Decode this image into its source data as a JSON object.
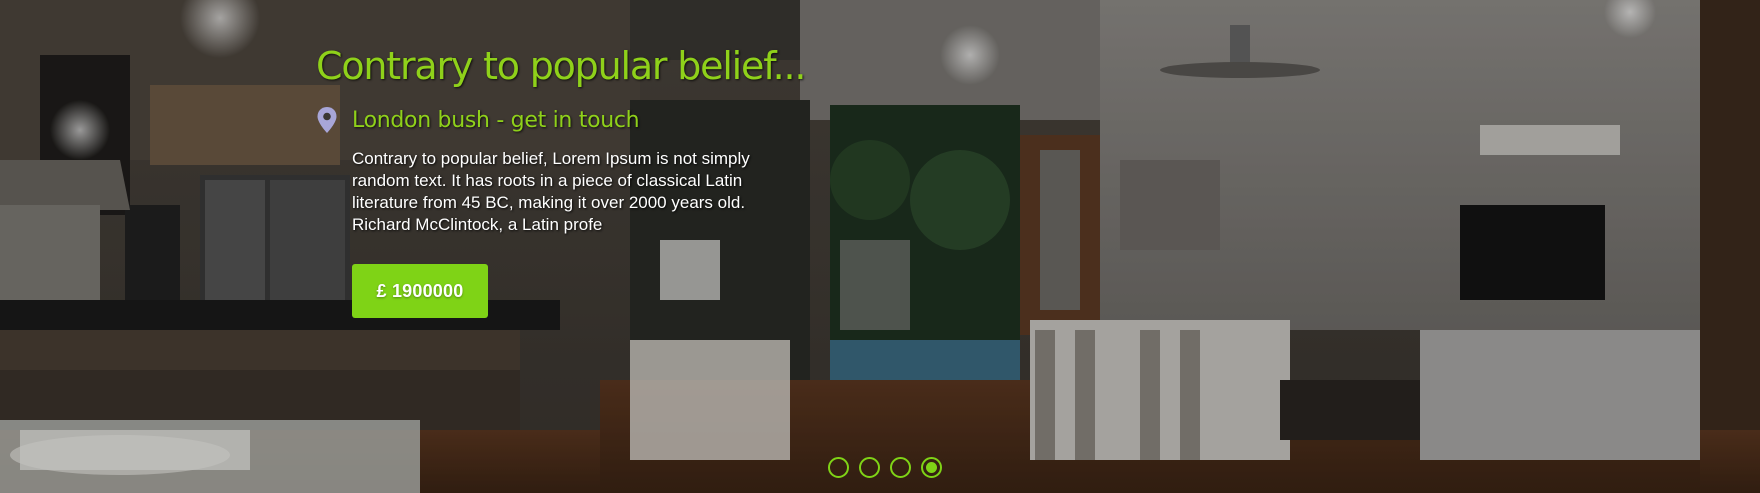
{
  "slide": {
    "title": "Contrary to popular belief...",
    "location": "London bush - get in touch",
    "description": "Contrary to popular belief, Lorem Ipsum is not simply random text. It has roots in a piece of classical Latin literature from 45 BC, making it over 2000 years old. Richard McClintock, a Latin profe",
    "price": "£ 1900000",
    "icon": "map-pin-icon"
  },
  "pagination": {
    "count": 4,
    "active_index": 3
  },
  "colors": {
    "accent": "#7fd316",
    "title": "#8fd11a",
    "text": "#ffffff",
    "pin": "#a8a6d8"
  }
}
